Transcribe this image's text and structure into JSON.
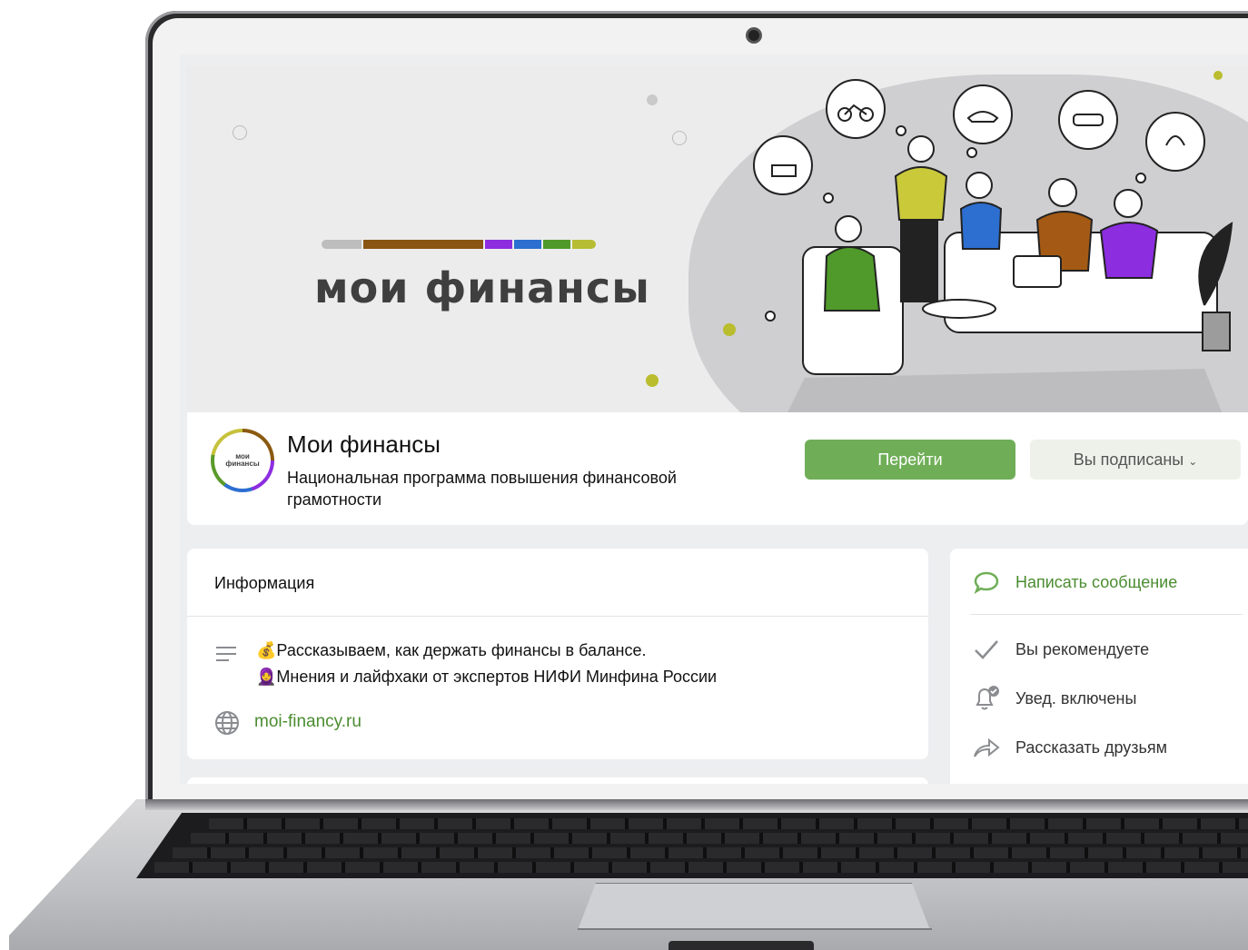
{
  "cover": {
    "logo_text": "мои финансы",
    "logo_bar_colors": [
      "#bdbdbd",
      "#8a5412",
      "#8c2de0",
      "#2c6fd0",
      "#4f9a2a",
      "#b7bd33"
    ]
  },
  "group": {
    "avatar_text": "мои финансы",
    "name": "Мои финансы",
    "description": "Национальная программа повышения финансовой грамотности",
    "go_button": "Перейти",
    "subscribed_button": "Вы подписаны",
    "subscribed_icon": "chevron-down-icon"
  },
  "info": {
    "title": "Информация",
    "line1": "💰Рассказываем, как держать финансы в балансе.",
    "line2": "🧕Мнения и лайфхаки от экспертов НИФИ Минфина России",
    "website": "moi-financy.ru"
  },
  "actions": {
    "write_message": "Написать сообщение",
    "recommend": "Вы рекомендуете",
    "notifications": "Увед. включены",
    "share": "Рассказать друзьям"
  },
  "colors": {
    "accent_green": "#6fae57",
    "link_green": "#4a8c30"
  }
}
